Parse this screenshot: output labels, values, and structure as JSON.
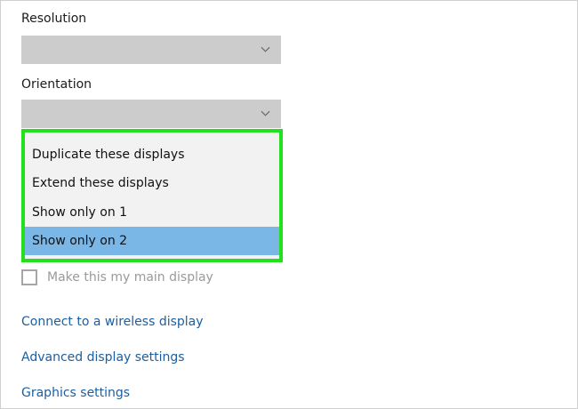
{
  "resolution": {
    "label": "Resolution",
    "value": ""
  },
  "orientation": {
    "label": "Orientation",
    "value": ""
  },
  "multiple_displays": {
    "options": [
      "Duplicate these displays",
      "Extend these displays",
      "Show only on 1",
      "Show only on 2"
    ],
    "selected": "Show only on 2",
    "highlight_color": "#22e01b",
    "selected_color": "#7ab6e6"
  },
  "main_display_checkbox": {
    "label": "Make this my main display",
    "checked": false
  },
  "links": [
    "Connect to a wireless display",
    "Advanced display settings",
    "Graphics settings"
  ],
  "colors": {
    "link": "#1b5fa0",
    "select_bg": "#cccccc"
  },
  "icons": {
    "dropdown": "chevron-down-icon"
  }
}
